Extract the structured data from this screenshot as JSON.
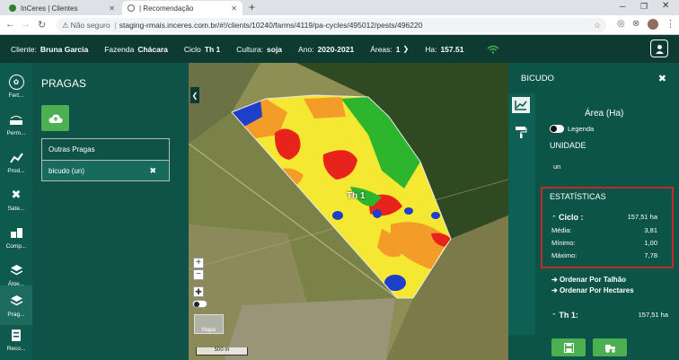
{
  "browser": {
    "tabs": [
      {
        "title": "InCeres | Clientes",
        "active": false
      },
      {
        "title": "| Recomendação",
        "active": true
      }
    ],
    "new_tab": "+",
    "security_label": "Não seguro",
    "url": "staging-rmais.inceres.com.br/#!/clients/10240/farms/4119/pa-cycles/495012/pests/496220"
  },
  "header": {
    "cliente_label": "Cliente:",
    "cliente_value": "Bruna Garcia",
    "fazenda_label": "Fazenda",
    "fazenda_value": "Chácara",
    "ciclo_label": "Ciclo",
    "ciclo_value": "Th 1",
    "cultura_label": "Cultura:",
    "cultura_value": "soja",
    "ano_label": "Ano:",
    "ano_value": "2020-2021",
    "areas_label": "Áreas:",
    "areas_value": "1",
    "ha_label": "Ha:",
    "ha_value": "157.51"
  },
  "rail": [
    {
      "label": "Fert...",
      "icon": "fertility-icon"
    },
    {
      "label": "Perm...",
      "icon": "permeability-icon"
    },
    {
      "label": "Prod...",
      "icon": "productivity-icon"
    },
    {
      "label": "Sate...",
      "icon": "satellite-icon"
    },
    {
      "label": "Comp...",
      "icon": "compaction-icon"
    },
    {
      "label": "Álge...",
      "icon": "layers-icon"
    },
    {
      "label": "Prag...",
      "icon": "pests-layers-icon"
    },
    {
      "label": "Reco...",
      "icon": "recommendation-icon"
    }
  ],
  "pragas": {
    "title": "PRAGAS",
    "items": [
      {
        "label": "Outras Pragas"
      },
      {
        "label": "bicudo (un)",
        "selected": true
      }
    ]
  },
  "map": {
    "zoom_in": "+",
    "zoom_out": "−",
    "label": "Th 1",
    "thumb_label": "Mapa",
    "scale_label": "500 m"
  },
  "panel": {
    "title": "BICUDO",
    "area_label": "Área (Ha)",
    "legend_label": "Legenda",
    "unidade_label": "UNIDADE",
    "unidade_value": "un",
    "stats_title": "ESTATÍSTICAS",
    "ciclo_label": "Ciclo :",
    "ciclo_value": "157,51 ha",
    "media_label": "Média:",
    "media_value": "3,81",
    "minimo_label": "Mínimo:",
    "minimo_value": "1,00",
    "maximo_label": "Máximo:",
    "maximo_value": "7,78",
    "sort_talhao": "Ordenar Por Talhão",
    "sort_hectares": "Ordenar Por Hectares",
    "th_label": "Th 1:",
    "th_value": "157,51 ha"
  },
  "colors": {
    "header_bg": "#0d3b32",
    "panel_bg": "#0f5247",
    "accent_green": "#4caf50",
    "stats_border": "#c62828"
  }
}
